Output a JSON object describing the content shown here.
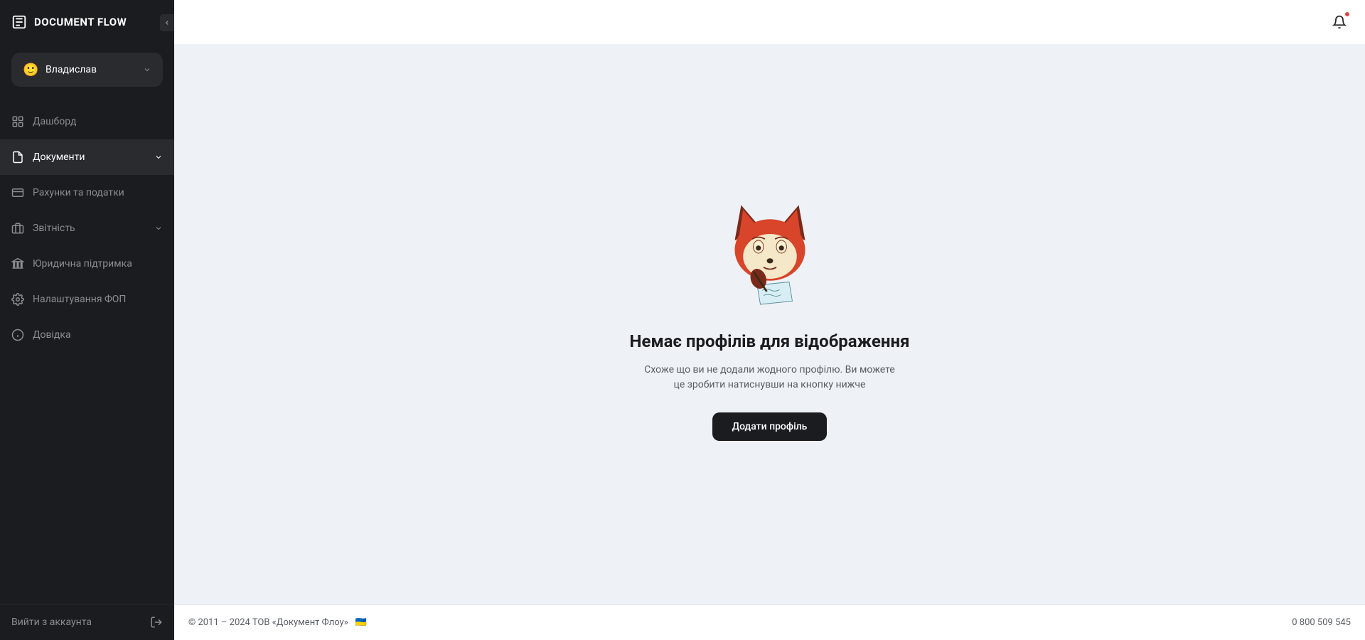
{
  "brand": "DOCUMENT FLOW",
  "user": {
    "name": "Владислав",
    "avatar_emoji": "🙂"
  },
  "nav": {
    "dashboard": "Дашборд",
    "documents": "Документи",
    "accounts_taxes": "Рахунки та податки",
    "reporting": "Звітність",
    "legal": "Юридична підтримка",
    "settings": "Налаштування ФОП",
    "help": "Довідка"
  },
  "logout": "Вийти з аккаунта",
  "empty_state": {
    "title": "Немає профілів для відображення",
    "description": "Схоже що ви не додали жодного профілю. Ви можете це зробити натиснувши на кнопку нижче",
    "button": "Додати профіль"
  },
  "footer": {
    "copyright": "© 2011 – 2024 ТОВ «Документ Флоу»",
    "flag": "🇺🇦",
    "phone": "0 800 509 545"
  }
}
